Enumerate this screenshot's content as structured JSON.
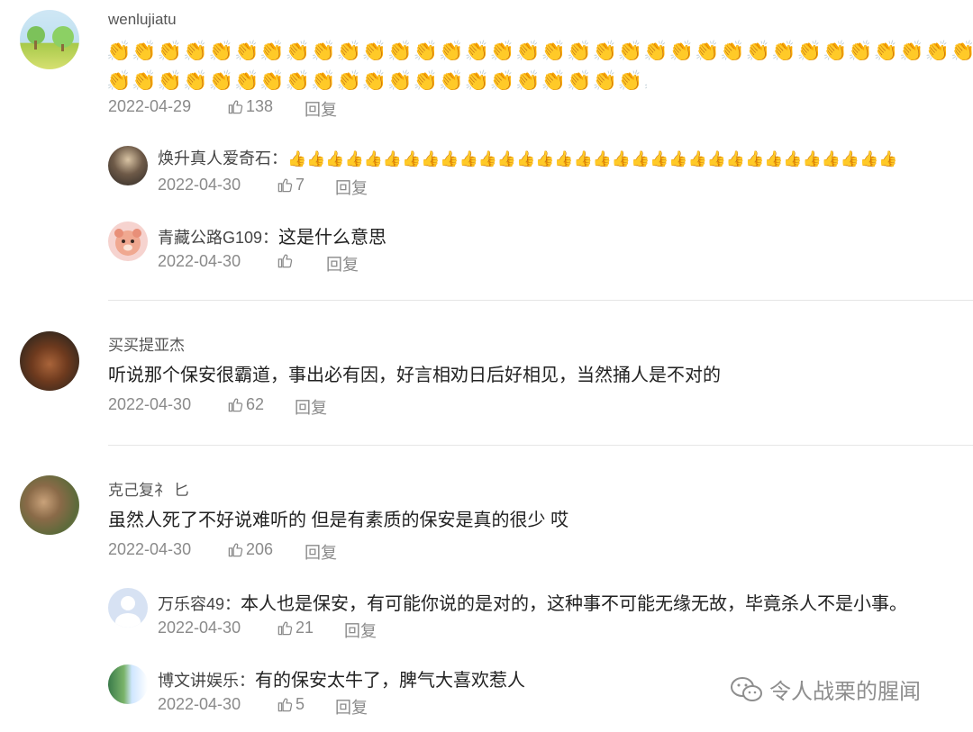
{
  "colors": {
    "text": "#222222",
    "meta": "#8a8a8a",
    "separator": "#e6e6e6"
  },
  "comments": [
    {
      "username": "wenlujiatu",
      "content_line1": "👏👏👏👏👏👏👏👏👏👏👏👏👏👏👏👏👏👏👏👏👏👏👏👏👏👏👏👏👏👏👏👏👏👏👏👏👏👏👏",
      "content_line2": "👏👏👏👏👏👏👏👏👏👏👏👏👏👏👏👏👏👏👏👏👏👏",
      "date": "2022-04-29",
      "likes": "138",
      "reply_label": "回复",
      "replies": [
        {
          "username": "焕升真人爱奇石：",
          "content": "👍👍👍👍👍👍👍👍👍👍👍👍👍👍👍👍👍👍👍👍👍👍👍👍👍👍👍👍👍👍👍👍",
          "date": "2022-04-30",
          "likes": "7",
          "reply_label": "回复"
        },
        {
          "username": "青藏公路G109：",
          "content": "这是什么意思",
          "date": "2022-04-30",
          "likes": "",
          "reply_label": "回复"
        }
      ]
    },
    {
      "username": "买买提亚杰",
      "content": "听说那个保安很霸道，事出必有因，好言相劝日后好相见，当然捅人是不对的",
      "date": "2022-04-30",
      "likes": "62",
      "reply_label": "回复"
    },
    {
      "username": "克己复礻 匕",
      "content": "虽然人死了不好说难听的 但是有素质的保安是真的很少 哎",
      "date": "2022-04-30",
      "likes": "206",
      "reply_label": "回复",
      "replies": [
        {
          "username": "万乐容49：",
          "content": "本人也是保安，有可能你说的是对的，这种事不可能无缘无故，毕竟杀人不是小事。",
          "date": "2022-04-30",
          "likes": "21",
          "reply_label": "回复"
        },
        {
          "username": "博文讲娱乐：",
          "content": "有的保安太牛了，脾气大喜欢惹人",
          "date": "2022-04-30",
          "likes": "5",
          "reply_label": "回复"
        }
      ]
    }
  ],
  "watermark": {
    "icon": "wechat-icon",
    "text": "令人战栗的腥闻"
  }
}
